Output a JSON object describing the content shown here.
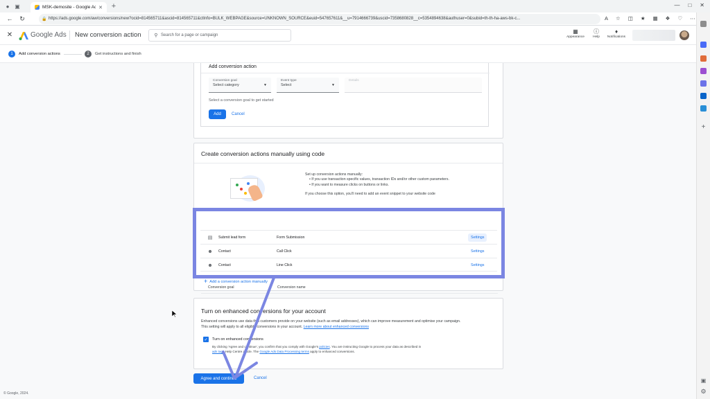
{
  "browser": {
    "tab_title": "MSK-demosite - Google Ads",
    "new_tab_label": "+",
    "url": "https://ads.google.com/aw/conversions/new?ocid=814565711&ascid=814565711&ctInfo=BULK_WEBPAGE&source=UNKNOWN_SOURCE&euid=547657611&__u=7914666739&uscid=7358680828__c=5354894638&authuser=0&subid=th-th-ha-aws-bk-c..."
  },
  "header": {
    "product_name": "Google Ads",
    "page_title": "New conversion action",
    "search_placeholder": "Search for a page or campaign",
    "actions": [
      {
        "label": "Appearance",
        "icon": "appearance-icon"
      },
      {
        "label": "Help",
        "icon": "help-icon"
      },
      {
        "label": "Notifications",
        "icon": "bell-icon"
      }
    ]
  },
  "steps": [
    {
      "number": "1",
      "label": "Add conversion actions",
      "active": true
    },
    {
      "number": "2",
      "label": "Get instructions and finish",
      "active": false
    }
  ],
  "add_card": {
    "title": "Add conversion action",
    "goal_field": {
      "label": "Conversion goal",
      "value": "Select category"
    },
    "event_field": {
      "label": "Event type",
      "value": "Select"
    },
    "details_field": {
      "label": "Details"
    },
    "hint": "Select a conversion goal to get started",
    "add_button": "Add",
    "cancel_link": "Cancel"
  },
  "manual_card": {
    "title": "Create conversion actions manually using code",
    "setup_intro": "Set up conversion actions manually:",
    "bullets": [
      "If you use transaction specific values, transaction IDs and/or other custom parameters.",
      "If you want to measure clicks on buttons or links."
    ],
    "snippet_note": "If you choose this option, you'll need to add an event snippet to your website code",
    "table": {
      "col_goal": "Conversion goal",
      "col_name": "Conversion name",
      "rows": [
        {
          "goal": "Submit lead form",
          "name": "Form Submission",
          "action": "Settings",
          "icon": "form-icon"
        },
        {
          "goal": "Contact",
          "name": "Call Click",
          "action": "Settings",
          "icon": "contact-icon"
        },
        {
          "goal": "Contact",
          "name": "Line Click",
          "action": "Settings",
          "icon": "contact-icon"
        }
      ]
    },
    "add_action_link": "Add a conversion action manually"
  },
  "enhanced_card": {
    "title": "Turn on enhanced conversions for your account",
    "desc_line1": "Enhanced conversions use data that customers provide on your website (such as email addresses), which can improve measurement and optimise your campaign.",
    "desc_line2": "This setting will apply to all eligible conversions in your account.",
    "learn_more": "Learn more about enhanced conversions",
    "checkbox_label": "Turn on enhanced conversions",
    "checked": true,
    "consent_line1": "By clicking 'Agree and continue', you confirm that you comply with Google's",
    "policies_link": "policies",
    "consent_line1b": ". You are instructing Google to process your data as described in",
    "consent_line2a": "ads tags",
    "consent_line2b": "Help Centre article. The",
    "terms_link": "Google Ads Data Processing terms",
    "consent_line2c": "apply to enhanced conversions."
  },
  "footer": {
    "agree_button": "Agree and continue",
    "cancel_button": "Cancel",
    "copyright": "© Google, 2024."
  },
  "colors": {
    "primary": "#1a73e8",
    "highlight_box": "#7b86e2",
    "arrow": "#7b86e2"
  }
}
